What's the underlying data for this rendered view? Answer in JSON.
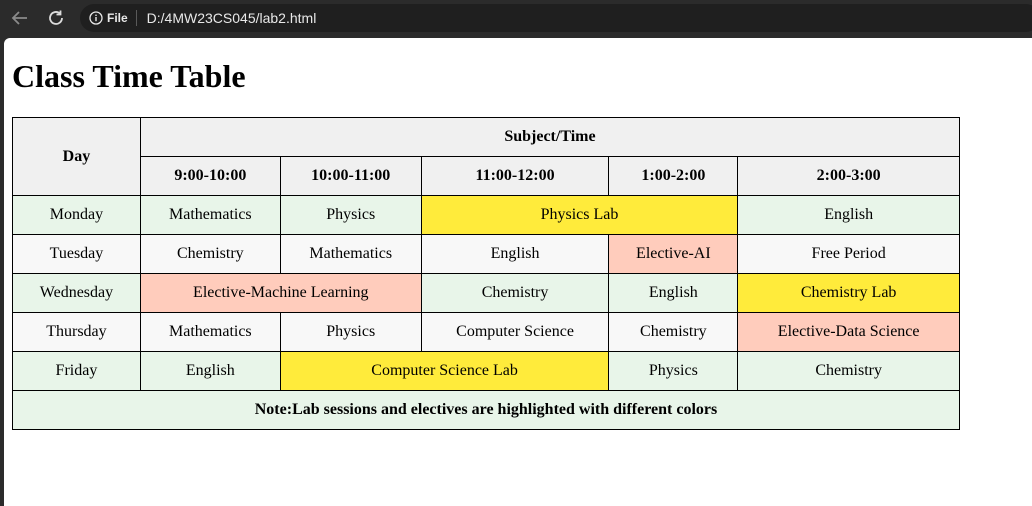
{
  "browser": {
    "site_info_label": "File",
    "url": "D:/4MW23CS045/lab2.html",
    "icons": [
      "back-arrow-icon",
      "reload-icon",
      "info-icon"
    ]
  },
  "page": {
    "title": "Class Time Table"
  },
  "timetable": {
    "header": {
      "day": "Day",
      "subject_time": "Subject/Time",
      "slots": [
        "9:00-10:00",
        "10:00-11:00",
        "11:00-12:00",
        "1:00-2:00",
        "2:00-3:00"
      ]
    },
    "rows": [
      {
        "day": "Monday",
        "cells": [
          "Mathematics",
          "Physics",
          "Physics Lab",
          "English"
        ]
      },
      {
        "day": "Tuesday",
        "cells": [
          "Chemistry",
          "Mathematics",
          "English",
          "Elective-AI",
          "Free Period"
        ]
      },
      {
        "day": "Wednesday",
        "cells": [
          "Elective-Machine Learning",
          "Chemistry",
          "English",
          "Chemistry Lab"
        ]
      },
      {
        "day": "Thursday",
        "cells": [
          "Mathematics",
          "Physics",
          "Computer Science",
          "Chemistry",
          "Elective-Data Science"
        ]
      },
      {
        "day": "Friday",
        "cells": [
          "English",
          "Computer Science Lab",
          "Physics",
          "Chemistry"
        ]
      }
    ],
    "note": "Note:Lab sessions and electives are highlighted with different colors"
  },
  "colors": {
    "lab": "#ffeb3b",
    "elective": "#ffccbc",
    "row_alt_green": "#e8f5e9",
    "row_alt_white": "#f8f8f8",
    "header_bg": "#f0f0f0"
  }
}
